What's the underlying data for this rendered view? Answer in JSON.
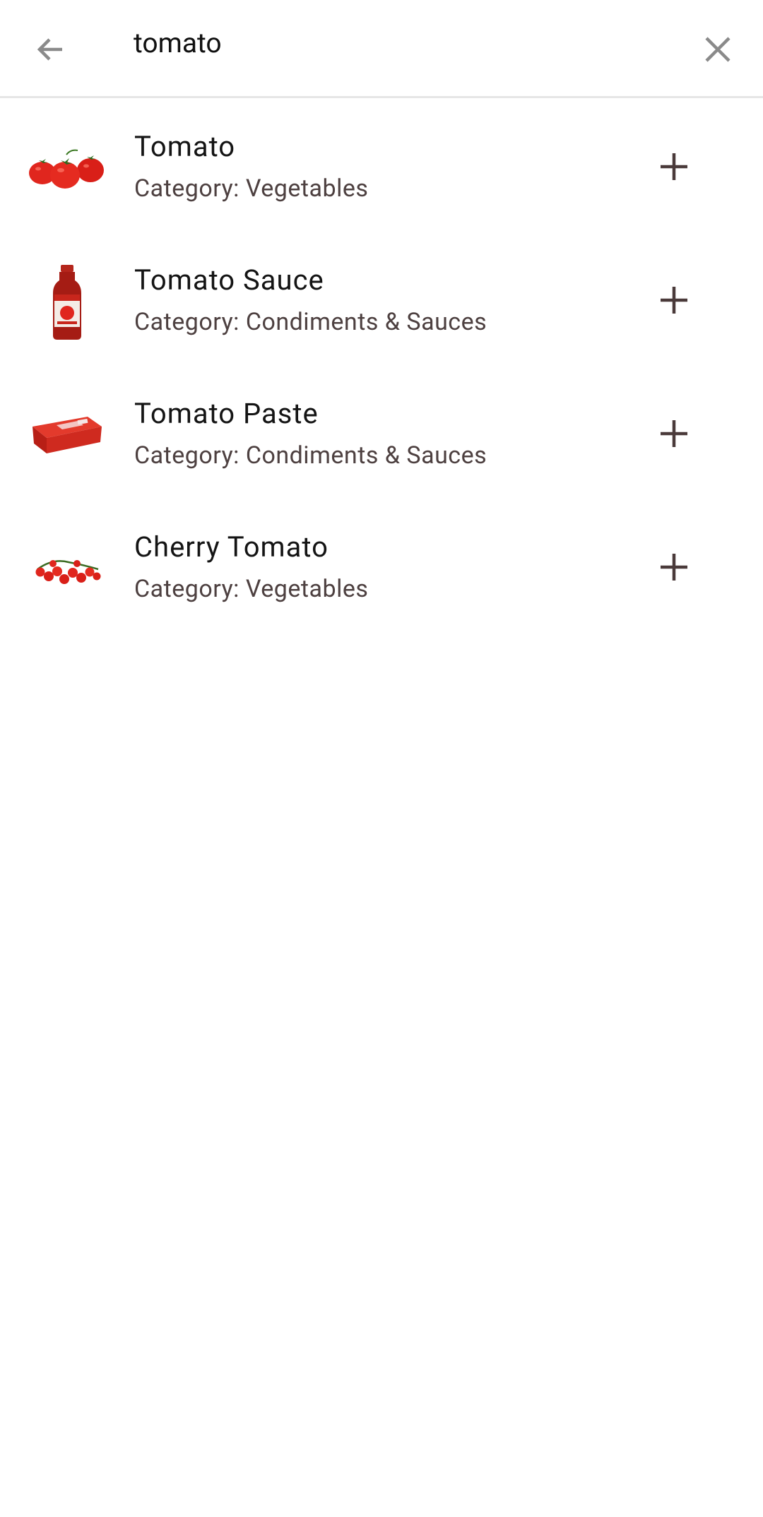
{
  "search": {
    "query": "tomato",
    "back_icon": "arrow-left-icon",
    "clear_icon": "close-icon"
  },
  "results": [
    {
      "title": "Tomato",
      "subtitle": "Category: Vegetables",
      "image": "tomato-image"
    },
    {
      "title": "Tomato Sauce",
      "subtitle": "Category: Condiments & Sauces",
      "image": "tomato-sauce-bottle-image"
    },
    {
      "title": "Tomato Paste",
      "subtitle": "Category: Condiments & Sauces",
      "image": "tomato-paste-pack-image"
    },
    {
      "title": "Cherry Tomato",
      "subtitle": "Category: Vegetables",
      "image": "cherry-tomato-image"
    }
  ],
  "colors": {
    "icon_gray": "#8a8a8a",
    "plus_brown": "#4a3a3a",
    "tomato_red": "#e0261e"
  }
}
